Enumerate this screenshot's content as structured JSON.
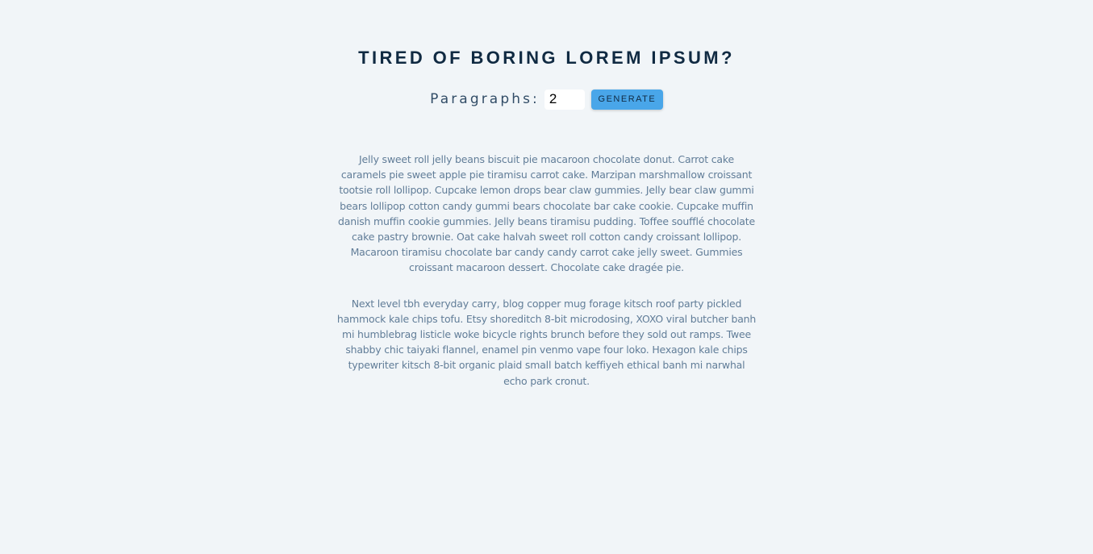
{
  "header": {
    "title": "TIRED OF BORING LOREM IPSUM?"
  },
  "form": {
    "label": "Paragraphs:",
    "amount_value": "2",
    "button_label": "Generate"
  },
  "paragraphs": [
    "Jelly sweet roll jelly beans biscuit pie macaroon chocolate donut. Carrot cake caramels pie sweet apple pie tiramisu carrot cake. Marzipan marshmallow croissant tootsie roll lollipop. Cupcake lemon drops bear claw gummies. Jelly bear claw gummi bears lollipop cotton candy gummi bears chocolate bar cake cookie. Cupcake muffin danish muffin cookie gummies. Jelly beans tiramisu pudding. Toffee soufflé chocolate cake pastry brownie. Oat cake halvah sweet roll cotton candy croissant lollipop. Macaroon tiramisu chocolate bar candy candy carrot cake jelly sweet. Gummies croissant macaroon dessert. Chocolate cake dragée pie.",
    "Next level tbh everyday carry, blog copper mug forage kitsch roof party pickled hammock kale chips tofu. Etsy shoreditch 8-bit microdosing, XOXO viral butcher banh mi humblebrag listicle woke bicycle rights brunch before they sold out ramps. Twee shabby chic taiyaki flannel, enamel pin venmo vape four loko. Hexagon kale chips typewriter kitsch 8-bit organic plaid small batch keffiyeh ethical banh mi narwhal echo park cronut."
  ]
}
